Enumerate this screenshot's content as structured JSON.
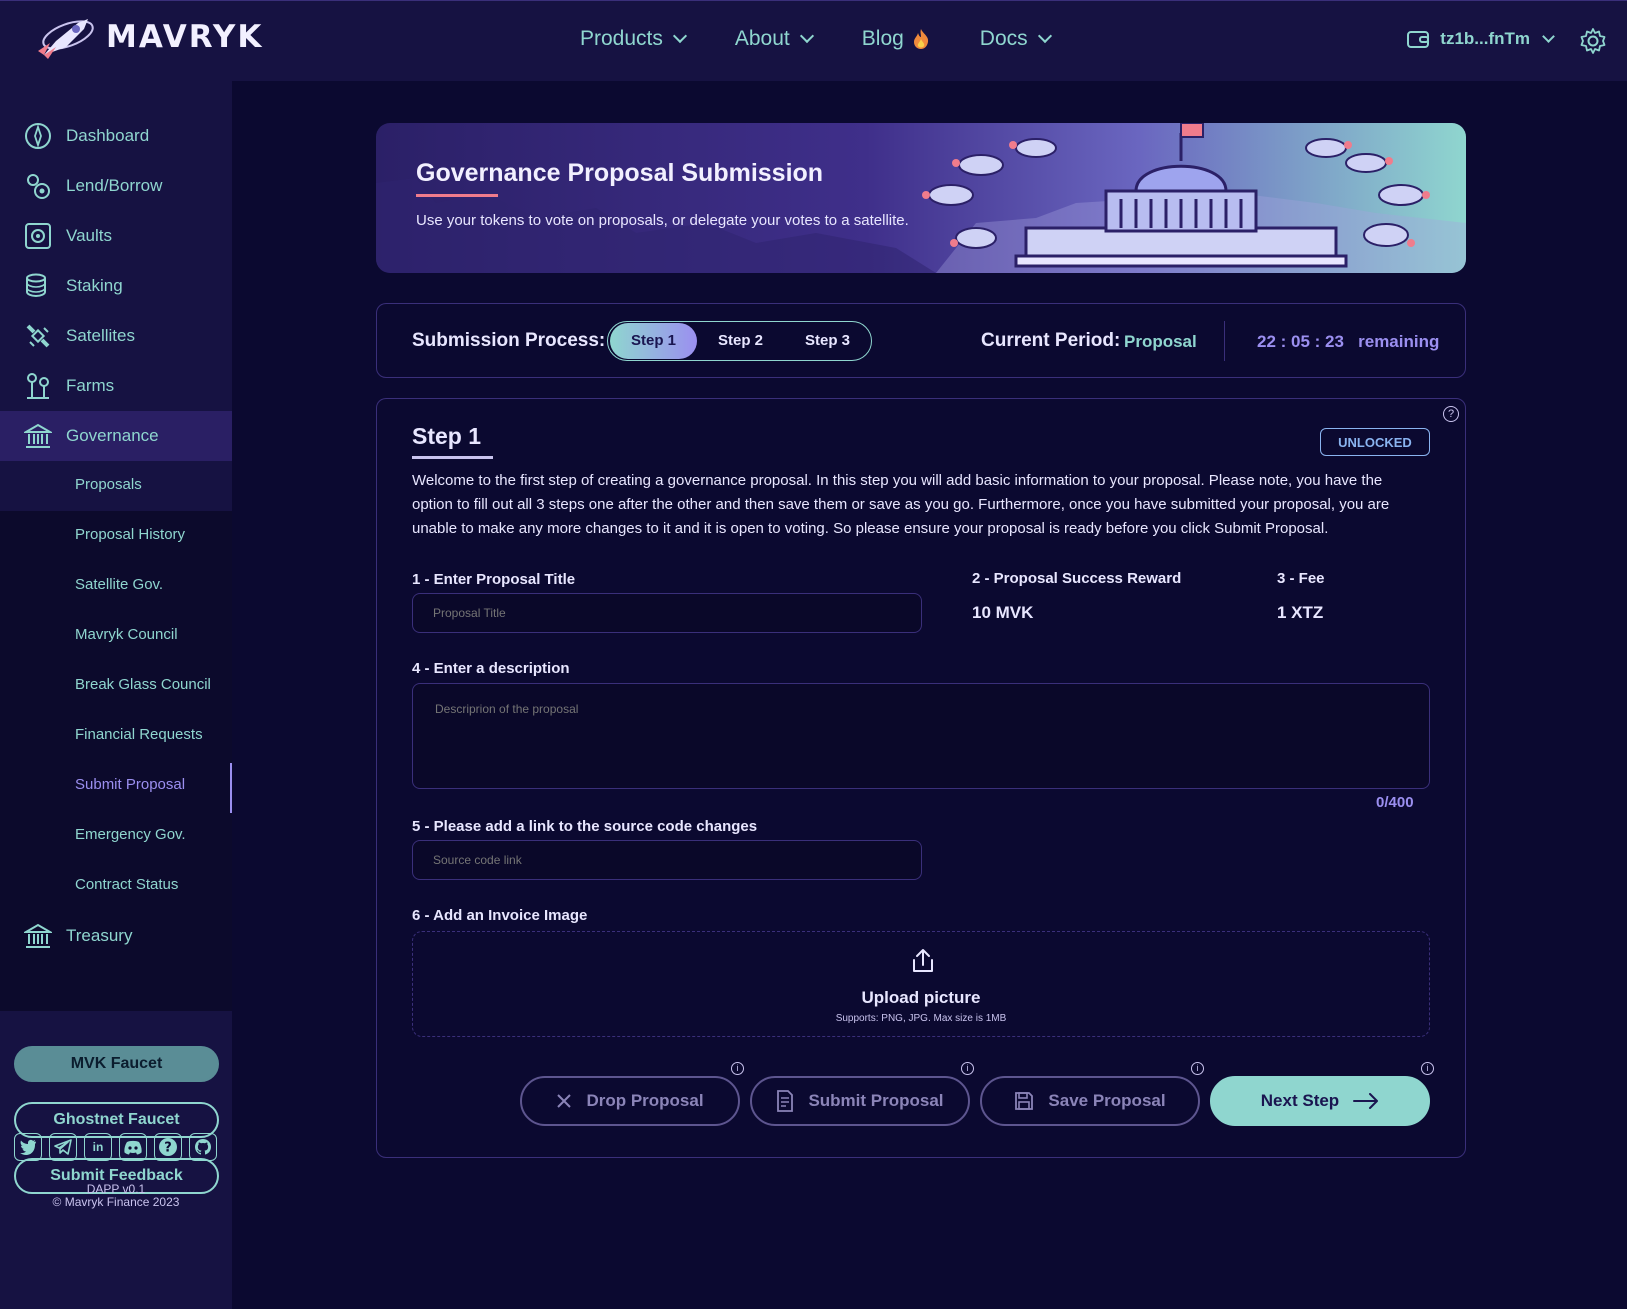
{
  "header": {
    "brand": "MAVRYK",
    "nav": [
      {
        "label": "Products"
      },
      {
        "label": "About"
      },
      {
        "label": "Blog"
      },
      {
        "label": "Docs"
      }
    ],
    "wallet_address": "tz1b...fnTm"
  },
  "sidebar": {
    "items": [
      {
        "label": "Dashboard",
        "icon": "dashboard-icon"
      },
      {
        "label": "Lend/Borrow",
        "icon": "lend-borrow-icon"
      },
      {
        "label": "Vaults",
        "icon": "vault-icon"
      },
      {
        "label": "Staking",
        "icon": "staking-icon"
      },
      {
        "label": "Satellites",
        "icon": "satellite-icon"
      },
      {
        "label": "Farms",
        "icon": "farm-icon"
      },
      {
        "label": "Governance",
        "icon": "governance-icon"
      },
      {
        "label": "Treasury",
        "icon": "treasury-icon"
      }
    ],
    "sub_items": [
      {
        "label": "Proposals"
      },
      {
        "label": "Proposal History"
      },
      {
        "label": "Satellite Gov."
      },
      {
        "label": "Mavryk Council"
      },
      {
        "label": "Break Glass Council"
      },
      {
        "label": "Financial Requests"
      },
      {
        "label": "Submit Proposal"
      },
      {
        "label": "Emergency Gov."
      },
      {
        "label": "Contract Status"
      }
    ],
    "buttons": {
      "mvk_faucet": "MVK Faucet",
      "ghostnet_faucet": "Ghostnet Faucet",
      "feedback": "Submit Feedback"
    },
    "socials": [
      "twitter-icon",
      "telegram-icon",
      "linkedin-icon",
      "discord-icon",
      "help-icon",
      "github-icon"
    ],
    "version": "DAPP v0.1",
    "copyright": "© Mavryk Finance 2023"
  },
  "banner": {
    "title": "Governance Proposal Submission",
    "subtitle": "Use your tokens to vote on proposals, or delegate your votes to a satellite."
  },
  "process": {
    "label": "Submission Process:",
    "steps": [
      "Step 1",
      "Step 2",
      "Step 3"
    ],
    "active_step": "Step 1",
    "period_label": "Current Period:",
    "period_value": "Proposal",
    "timer": "22 : 05 : 23",
    "timer_suffix": "remaining"
  },
  "form": {
    "title": "Step 1",
    "status": "UNLOCKED",
    "intro": "Welcome to the first step of creating a governance proposal. In this step you will add basic information to your proposal. Please note, you have the option to fill out all 3 steps one after the other and then save them or save as you go. Furthermore, once you have submitted your proposal, you are unable to make any more changes to it and it is open to voting. So please ensure your proposal is ready before you click Submit Proposal.",
    "title_label": "1 - Enter Proposal Title",
    "title_placeholder": "Proposal Title",
    "reward_label": "2 - Proposal Success Reward",
    "reward_value": "10 MVK",
    "fee_label": "3 - Fee",
    "fee_value": "1 XTZ",
    "description_label": "4 - Enter a description",
    "description_placeholder": "Descriprion of the proposal",
    "description_counter": "0/400",
    "source_label": "5 - Please add a link to the source code changes",
    "source_placeholder": "Source code link",
    "invoice_label": "6 - Add an Invoice Image",
    "upload_title": "Upload picture",
    "upload_hint": "Supports: PNG, JPG. Max size is 1MB",
    "buttons": {
      "drop": "Drop Proposal",
      "submit": "Submit Proposal",
      "save": "Save Proposal",
      "next": "Next Step"
    }
  },
  "colors": {
    "accent": "#8fd6cf",
    "secondary": "#9b8ff0",
    "background": "#0b0930",
    "panel": "#161242"
  }
}
